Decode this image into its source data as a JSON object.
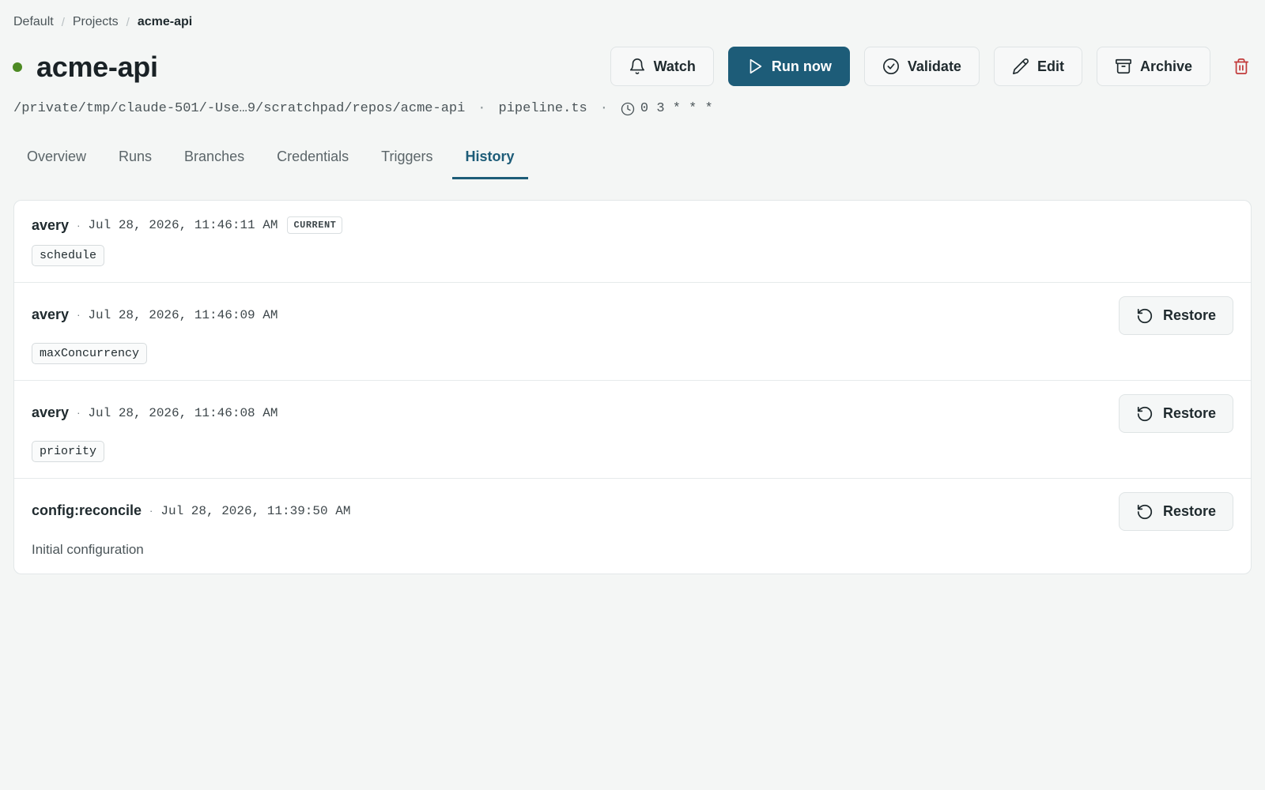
{
  "breadcrumb": {
    "items": [
      "Default",
      "Projects",
      "acme-api"
    ],
    "separator": "/"
  },
  "header": {
    "title": "acme-api",
    "status_color": "#4d8a23",
    "actions": {
      "watch": "Watch",
      "run_now": "Run now",
      "validate": "Validate",
      "edit": "Edit",
      "archive": "Archive"
    }
  },
  "meta": {
    "path": "/private/tmp/claude-501/-Use…9/scratchpad/repos/acme-api",
    "file": "pipeline.ts",
    "cron": "0 3 * * *",
    "separator": "·"
  },
  "tabs": [
    {
      "label": "Overview",
      "active": false
    },
    {
      "label": "Runs",
      "active": false
    },
    {
      "label": "Branches",
      "active": false
    },
    {
      "label": "Credentials",
      "active": false
    },
    {
      "label": "Triggers",
      "active": false
    },
    {
      "label": "History",
      "active": true
    }
  ],
  "history": {
    "restore_label": "Restore",
    "current_label": "CURRENT",
    "entries": [
      {
        "author": "avery",
        "timestamp": "Jul 28, 2026, 11:46:11 AM",
        "change": "schedule",
        "current": true
      },
      {
        "author": "avery",
        "timestamp": "Jul 28, 2026, 11:46:09 AM",
        "change": "maxConcurrency",
        "current": false
      },
      {
        "author": "avery",
        "timestamp": "Jul 28, 2026, 11:46:08 AM",
        "change": "priority",
        "current": false
      },
      {
        "author": "config:reconcile",
        "timestamp": "Jul 28, 2026, 11:39:50 AM",
        "description": "Initial configuration",
        "current": false
      }
    ]
  },
  "colors": {
    "accent": "#1d5c78",
    "danger": "#c23b3b",
    "background": "#f4f6f5"
  }
}
